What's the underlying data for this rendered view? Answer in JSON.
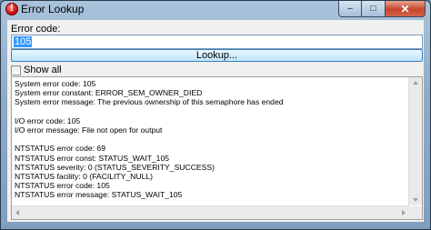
{
  "window": {
    "title": "Error Lookup",
    "minimize": "–",
    "maximize": "□",
    "close": "✕"
  },
  "form": {
    "code_label": "Error code:",
    "code_value": "105",
    "lookup_label": "Lookup...",
    "show_all_label": "Show all",
    "show_all_checked": false
  },
  "output": {
    "lines": [
      "System error code: 105",
      "System error constant: ERROR_SEM_OWNER_DIED",
      "System error message: The previous ownership of this semaphore has ended",
      "",
      "I/O error code: 105",
      "I/O error message: File not open for output",
      "",
      "NTSTATUS error code: 69",
      "NTSTATUS error const: STATUS_WAIT_105",
      "NTSTATUS severity: 0 (STATUS_SEVERITY_SUCCESS)",
      "NTSTATUS facility: 0 (FACILITY_NULL)",
      "NTSTATUS error code: 105",
      "NTSTATUS error message: STATUS_WAIT_105"
    ]
  },
  "icons": {
    "app": "error-icon"
  }
}
